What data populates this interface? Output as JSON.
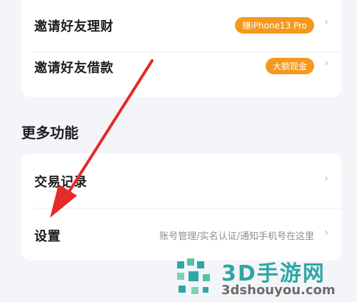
{
  "top_card": {
    "item1": {
      "label": "邀请好友理财",
      "badge": "赚iPhone13 Pro",
      "badge_color": "#f39a1e"
    },
    "item2": {
      "label": "邀请好友借款",
      "badge": "大额现金",
      "badge_color": "#f39a1e"
    }
  },
  "section_title": "更多功能",
  "bottom_card": {
    "item1": {
      "label": "交易记录"
    },
    "item2": {
      "label": "设置",
      "detail": "账号管理/实名认证/通知手机号在这里"
    }
  },
  "chevron": "›",
  "annotation": {
    "arrow_color": "#e52a2a"
  },
  "watermark": {
    "main": "3D手游网",
    "sub": "3dshouyou.com",
    "color": "#2fa7a4"
  }
}
